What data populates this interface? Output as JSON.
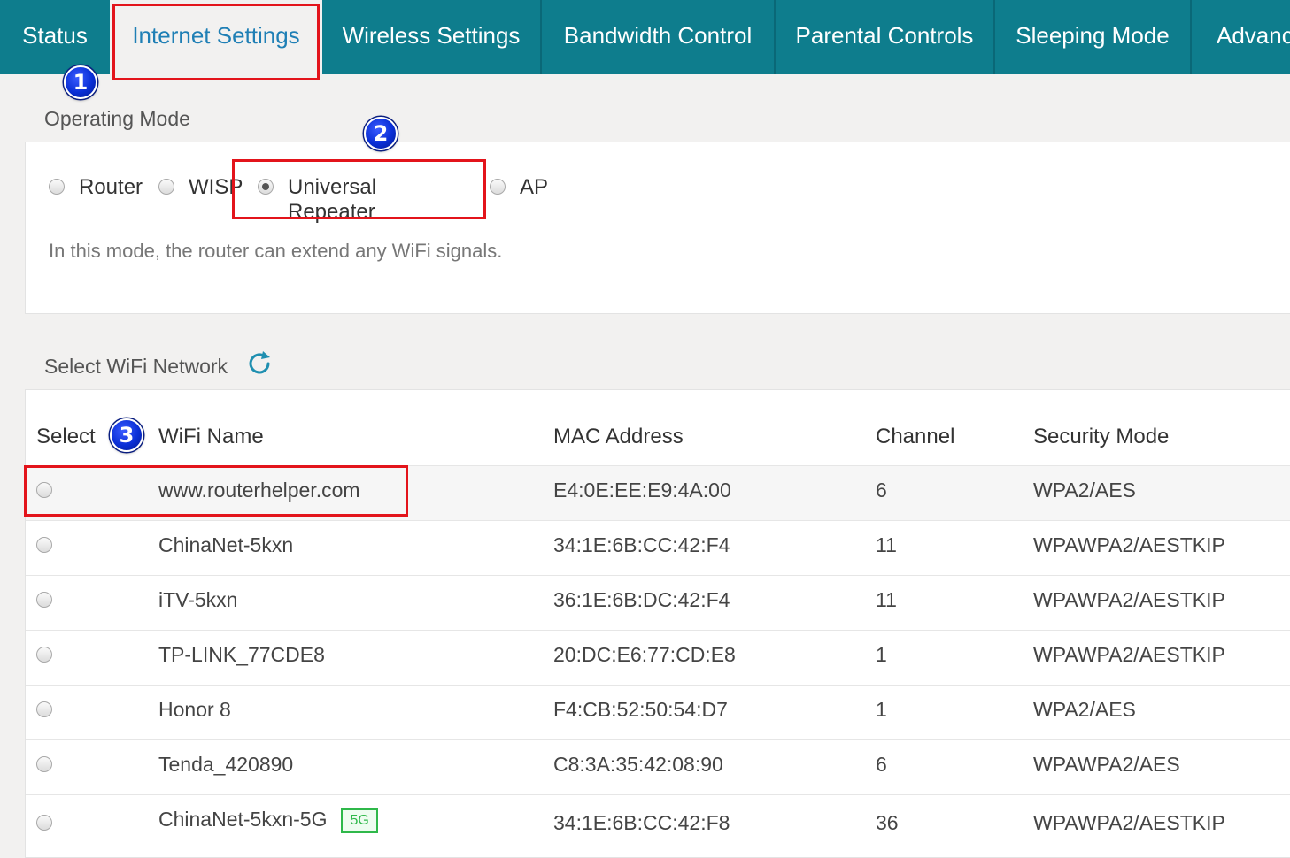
{
  "nav": {
    "tabs": [
      {
        "label": "Status"
      },
      {
        "label": "Internet Settings",
        "active": true
      },
      {
        "label": "Wireless Settings"
      },
      {
        "label": "Bandwidth Control"
      },
      {
        "label": "Parental Controls"
      },
      {
        "label": "Sleeping Mode"
      },
      {
        "label": "Advanc"
      }
    ]
  },
  "steps": [
    "1",
    "2",
    "3"
  ],
  "operating_mode": {
    "title": "Operating Mode",
    "options": [
      {
        "label": "Router",
        "checked": false
      },
      {
        "label": "WISP",
        "checked": false
      },
      {
        "label": "Universal Repeater",
        "checked": true
      },
      {
        "label": "AP",
        "checked": false
      }
    ],
    "description": "In this mode, the router can extend any WiFi signals."
  },
  "wifi": {
    "title": "Select WiFi Network",
    "refresh_icon": "refresh-icon",
    "columns": [
      "Select",
      "WiFi Name",
      "MAC Address",
      "Channel",
      "Security Mode"
    ],
    "rows": [
      {
        "name": "www.routerhelper.com",
        "mac": "E4:0E:EE:E9:4A:00",
        "channel": "6",
        "security": "WPA2/AES"
      },
      {
        "name": "ChinaNet-5kxn",
        "mac": "34:1E:6B:CC:42:F4",
        "channel": "11",
        "security": "WPAWPA2/AESTKIP"
      },
      {
        "name": "iTV-5kxn",
        "mac": "36:1E:6B:DC:42:F4",
        "channel": "11",
        "security": "WPAWPA2/AESTKIP"
      },
      {
        "name": "TP-LINK_77CDE8",
        "mac": "20:DC:E6:77:CD:E8",
        "channel": "1",
        "security": "WPAWPA2/AESTKIP"
      },
      {
        "name": "Honor 8",
        "mac": "F4:CB:52:50:54:D7",
        "channel": "1",
        "security": "WPA2/AES"
      },
      {
        "name": "Tenda_420890",
        "mac": "C8:3A:35:42:08:90",
        "channel": "6",
        "security": "WPAWPA2/AES"
      },
      {
        "name": "ChinaNet-5kxn-5G",
        "badge": "5G",
        "mac": "34:1E:6B:CC:42:F8",
        "channel": "36",
        "security": "WPAWPA2/AESTKIP"
      }
    ]
  },
  "colors": {
    "nav_bg": "#0e7d8d",
    "active_tab_text": "#1f7fb5",
    "highlight": "#e3141b",
    "step_badge": "#0a2fd6",
    "band_badge": "#2fb84a"
  }
}
